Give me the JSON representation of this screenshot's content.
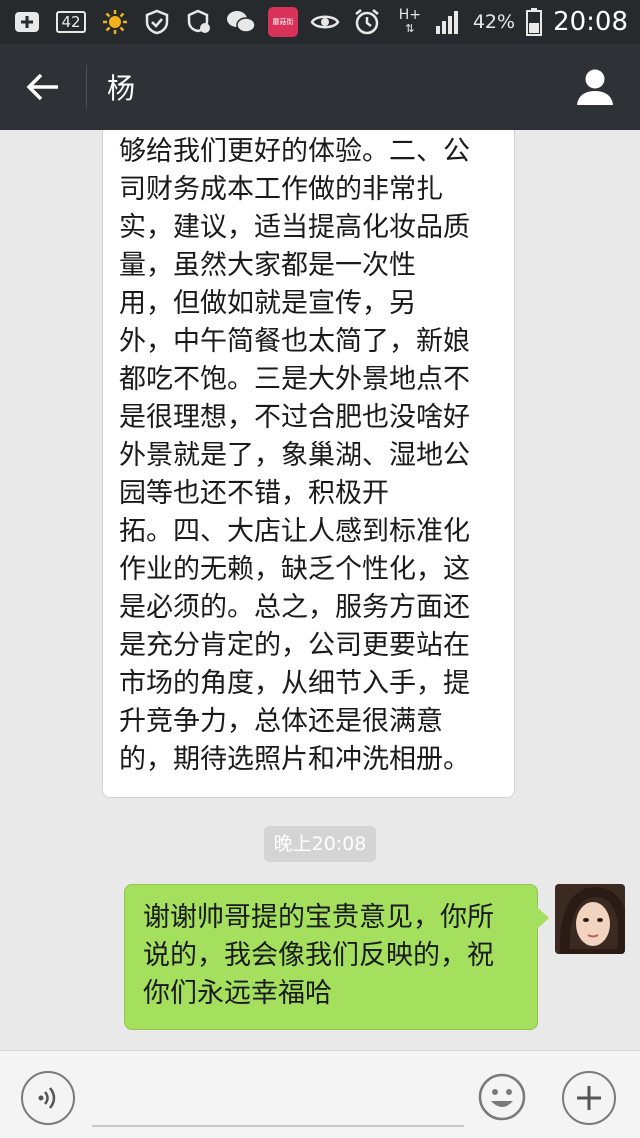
{
  "status_bar": {
    "icons": [
      "plus-box-icon",
      "notification-badge-icon",
      "sun-icon",
      "shield-check-icon",
      "shield-badge-icon",
      "wechat-icon",
      "app-red-icon",
      "eye-icon",
      "alarm-icon",
      "network-icon",
      "signal-icon",
      "battery-icon"
    ],
    "badge_count": "42",
    "app_label": "蘑菇街",
    "network_type": "H+",
    "battery_percent": "42%",
    "time": "20:08"
  },
  "header": {
    "title": "杨",
    "back_icon": "arrow-left-icon",
    "profile_icon": "person-icon"
  },
  "messages": [
    {
      "side": "left",
      "text": "够给我们更好的体验。二、公\n司财务成本工作做的非常扎\n实，建议，适当提高化妆品质\n量，虽然大家都是一次性\n用，但做如就是宣传，另\n外，中午简餐也太简了，新娘\n都吃不饱。三是大外景地点不\n是很理想，不过合肥也没啥好\n外景就是了，象巢湖、湿地公\n园等也还不错，积极开\n拓。四、大店让人感到标准化\n作业的无赖，缺乏个性化，这\n是必须的。总之，服务方面还\n是充分肯定的，公司更要站在\n市场的角度，从细节入手，提\n升竞争力，总体还是很满意\n的，期待选照片和冲洗相册。"
    },
    {
      "side": "timestamp",
      "text": "晚上20:08"
    },
    {
      "side": "right",
      "text": "谢谢帅哥提的宝贵意见，你所\n说的，我会像我们反映的，祝\n你们永远幸福哈"
    }
  ],
  "input_bar": {
    "text_value": "",
    "voice_icon": "voice-icon",
    "emoji_icon": "emoji-icon",
    "plus_icon": "plus-icon"
  },
  "colors": {
    "status_bar_bg": "#262a2d",
    "header_bg": "#2e3236",
    "chat_bg": "#e9e9e9",
    "sent_bubble": "#a5df5e",
    "received_bubble": "#ffffff"
  }
}
